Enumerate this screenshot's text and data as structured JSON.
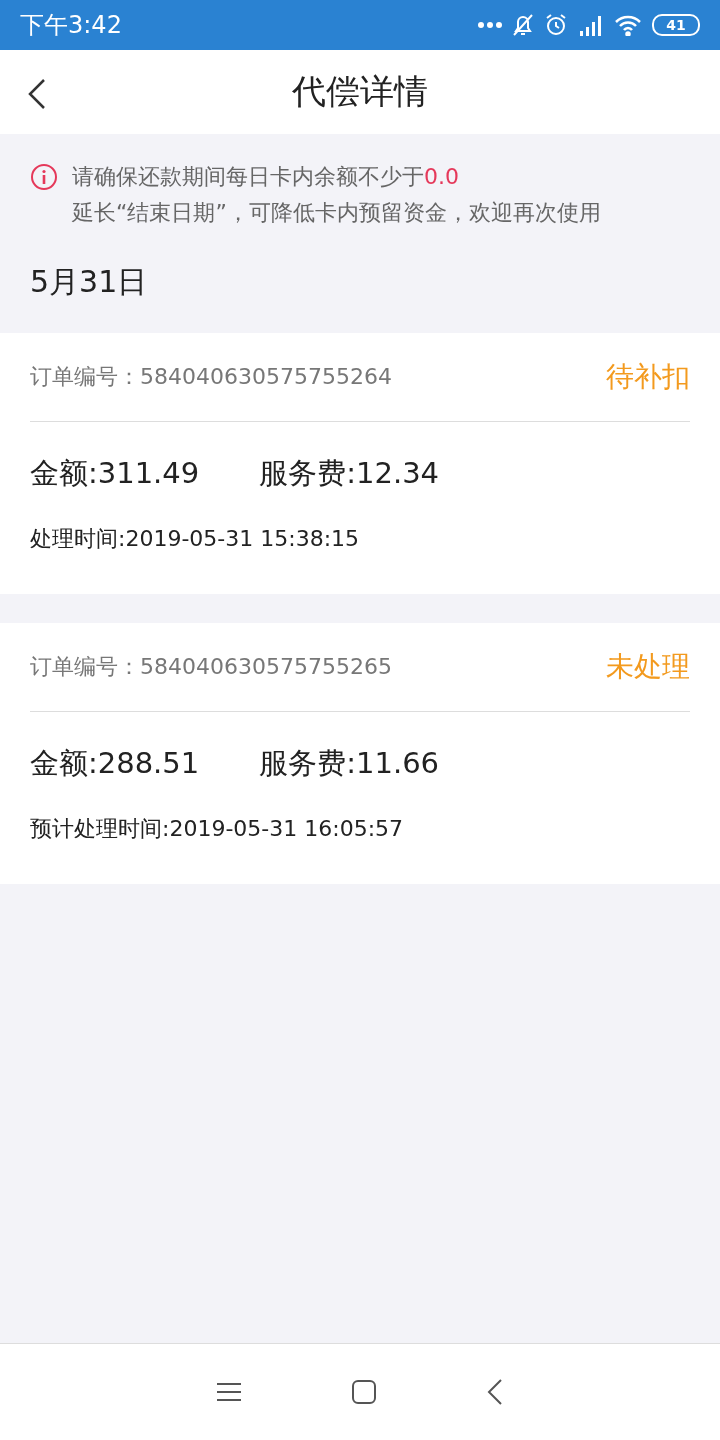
{
  "status_bar": {
    "time": "下午3:42",
    "battery": "41"
  },
  "header": {
    "title": "代偿详情"
  },
  "notice": {
    "line1": "请确保还款期间每日卡内余额不少于",
    "amount": "0.0",
    "line2": "延长“结束日期”，可降低卡内预留资金，欢迎再次使用"
  },
  "date": "5月31日",
  "orders": [
    {
      "order_no": "订单编号：584040630575755264",
      "status": "待补扣",
      "amount": "金额:311.49",
      "fee": "服务费:12.34",
      "time": "处理时间:2019-05-31 15:38:15"
    },
    {
      "order_no": "订单编号：584040630575755265",
      "status": "未处理",
      "amount": "金额:288.51",
      "fee": "服务费:11.66",
      "time": "预计处理时间:2019-05-31 16:05:57"
    }
  ]
}
